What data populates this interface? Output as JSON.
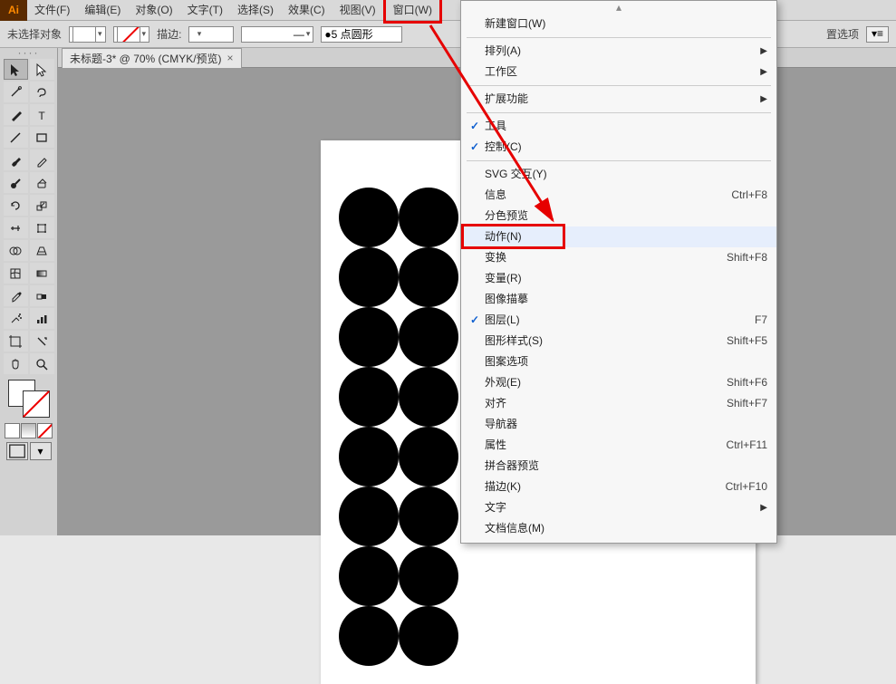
{
  "app_logo": "Ai",
  "menubar": [
    "文件(F)",
    "编辑(E)",
    "对象(O)",
    "文字(T)",
    "选择(S)",
    "效果(C)",
    "视图(V)",
    "窗口(W)"
  ],
  "control": {
    "noselect": "未选择对象",
    "stroke_label": "描边:",
    "pt_value": "5 点圆形",
    "right_label": "置选项",
    "more": "▼▼"
  },
  "doc_tab": {
    "title": "未标题-3* @ 70% (CMYK/预览)",
    "close": "×"
  },
  "dropdown": {
    "items": [
      {
        "label": "新建窗口(W)",
        "check": "",
        "accel": "",
        "sub": false
      },
      {
        "sep": true
      },
      {
        "label": "排列(A)",
        "check": "",
        "accel": "",
        "sub": true
      },
      {
        "label": "工作区",
        "check": "",
        "accel": "",
        "sub": true
      },
      {
        "sep": true
      },
      {
        "label": "扩展功能",
        "check": "",
        "accel": "",
        "sub": true
      },
      {
        "sep": true
      },
      {
        "label": "工具",
        "check": "✓",
        "accel": "",
        "sub": false
      },
      {
        "label": "控制(C)",
        "check": "✓",
        "accel": "",
        "sub": false
      },
      {
        "sep": true
      },
      {
        "label": "SVG 交互(Y)",
        "check": "",
        "accel": "",
        "sub": false
      },
      {
        "label": "信息",
        "check": "",
        "accel": "Ctrl+F8",
        "sub": false
      },
      {
        "label": "分色预览",
        "check": "",
        "accel": "",
        "sub": false
      },
      {
        "label": "动作(N)",
        "check": "",
        "accel": "",
        "sub": false,
        "hl": true,
        "box": true
      },
      {
        "label": "变换",
        "check": "",
        "accel": "Shift+F8",
        "sub": false
      },
      {
        "label": "变量(R)",
        "check": "",
        "accel": "",
        "sub": false
      },
      {
        "label": "图像描摹",
        "check": "",
        "accel": "",
        "sub": false
      },
      {
        "label": "图层(L)",
        "check": "✓",
        "accel": "F7",
        "sub": false
      },
      {
        "label": "图形样式(S)",
        "check": "",
        "accel": "Shift+F5",
        "sub": false
      },
      {
        "label": "图案选项",
        "check": "",
        "accel": "",
        "sub": false
      },
      {
        "label": "外观(E)",
        "check": "",
        "accel": "Shift+F6",
        "sub": false
      },
      {
        "label": "对齐",
        "check": "",
        "accel": "Shift+F7",
        "sub": false
      },
      {
        "label": "导航器",
        "check": "",
        "accel": "",
        "sub": false
      },
      {
        "label": "属性",
        "check": "",
        "accel": "Ctrl+F11",
        "sub": false
      },
      {
        "label": "拼合器预览",
        "check": "",
        "accel": "",
        "sub": false
      },
      {
        "label": "描边(K)",
        "check": "",
        "accel": "Ctrl+F10",
        "sub": false
      },
      {
        "label": "文字",
        "check": "",
        "accel": "",
        "sub": true
      },
      {
        "label": "文档信息(M)",
        "check": "",
        "accel": "",
        "sub": false
      }
    ]
  },
  "tools": {
    "names": [
      "selection",
      "direct-selection",
      "magic-wand",
      "lasso",
      "pen",
      "type",
      "line",
      "rectangle",
      "paintbrush",
      "pencil",
      "blob-brush",
      "eraser",
      "rotate",
      "scale",
      "width",
      "free-transform",
      "shape-builder",
      "perspective",
      "mesh",
      "gradient",
      "eyedropper",
      "blend",
      "symbol-sprayer",
      "graph",
      "artboard",
      "slice",
      "hand",
      "zoom"
    ]
  }
}
